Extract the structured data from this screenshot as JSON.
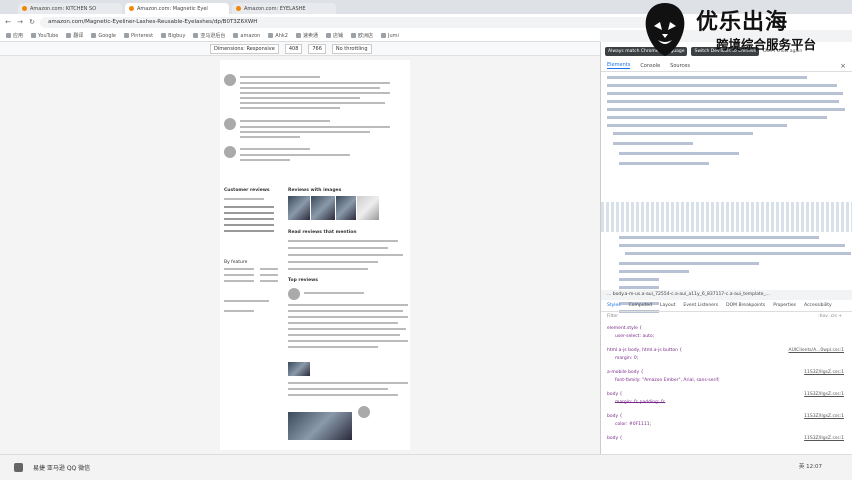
{
  "browser": {
    "tabs": [
      {
        "label": "Amazon.com: KITCHEN SO"
      },
      {
        "label": "Amazon.com: Magnetic Eyel",
        "active": true
      },
      {
        "label": "Amazon.com: EYELASHE"
      }
    ],
    "url": "amazon.com/Magnetic-Eyeliner-Lashes-Reusable-Eyelashes/dp/B0T3Z6XWH",
    "bookmarks": [
      "应用",
      "YouTube",
      "翻译",
      "Google",
      "Pinterest",
      "Bigbuy",
      "亚马逊后台",
      "amazon",
      "Ahk2",
      "速卖通",
      "店铺",
      "欧洲店",
      "Jumi"
    ]
  },
  "device_toolbar": {
    "device": "Dimensions: Responsive",
    "width": "408",
    "height": "766",
    "throttle": "No throttling"
  },
  "page": {
    "section_customer_reviews": "Customer reviews",
    "section_reviews_with_images": "Reviews with images",
    "section_read_more": "Read reviews that mention",
    "section_top_reviews": "Top reviews"
  },
  "devtools": {
    "notice": "Always match Chrome's language",
    "notice_switch": "Switch DevTools to Chinese",
    "notice_dont": "Don't show again",
    "tabs": [
      "Elements",
      "Console",
      "Sources"
    ],
    "breadcrumb": "... body.a-m-us.a-aui_72554-c.a-aui_a11y_6_837117-c.a-aui_template_...",
    "style_tabs": [
      "Styles",
      "Computed",
      "Layout",
      "Event Listeners",
      "DOM Breakpoints",
      "Properties",
      "Accessibility"
    ],
    "filter_placeholder": "Filter",
    "filter_right": ":hov .cls +",
    "rules": [
      {
        "sel": "element.style {",
        "val": "user-select: auto;",
        "src": ""
      },
      {
        "sel": "html.a-js body, html.a-js button {",
        "val": "margin: 0;",
        "src": "AUIClients/A...0wpl.css:1"
      },
      {
        "sel": "a-mobile body {",
        "val": "font-family: \"Amazon Ember\", Arial, sans-serif;",
        "src": "11S3Z/lIgsZ.css:1"
      },
      {
        "sel": "body {",
        "val": "margin: 0; padding: 0;",
        "src": "11S3Z/lIgsZ.css:1"
      },
      {
        "sel": "body {",
        "val": "color: #0F1111;",
        "src": "11S3Z/lIgsZ.css:1"
      },
      {
        "sel": "body {",
        "val": "",
        "src": "11S3Z/lIgsZ.css:1"
      }
    ]
  },
  "taskbar": {
    "apps": "易捷 亚马逊 QQ 微信",
    "tray": "英 12:07"
  },
  "watermark": {
    "line1": "优乐出海",
    "line2": "跨境综合服务平台"
  }
}
